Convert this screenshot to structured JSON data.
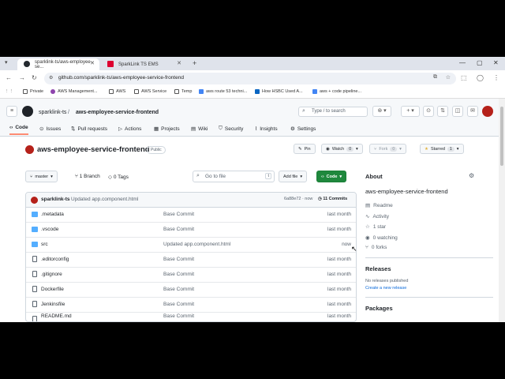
{
  "browser": {
    "tabs": [
      {
        "title": "sparklink-ts/aws-employee-se...",
        "active": true
      },
      {
        "title": "SparkLink TS EMS",
        "active": false
      }
    ],
    "new_tab": "+",
    "url": "github.com/sparklink-ts/aws-employee-service-frontend",
    "bookmarks": [
      "Private",
      "AWS Management...",
      "AWS",
      "AWS Service",
      "Temp",
      "aws route 53 techni...",
      "How HSBC Used A...",
      "aws + code pipeline..."
    ]
  },
  "gh": {
    "owner": "sparklink-ts",
    "sep": "/",
    "repo": "aws-employee-service-frontend",
    "search_placeholder": "Type / to search",
    "nav": [
      "Code",
      "Issues",
      "Pull requests",
      "Actions",
      "Projects",
      "Wiki",
      "Security",
      "Insights",
      "Settings"
    ],
    "repo_title": "aws-employee-service-frontend",
    "visibility": "Public",
    "pin": "Pin",
    "watch": "Watch",
    "watch_count": "0",
    "fork": "Fork",
    "fork_count": "0",
    "starred": "Starred",
    "star_count": "1",
    "branch": "master",
    "branches": "1 Branch",
    "tags": "0 Tags",
    "goto_placeholder": "Go to file",
    "goto_key": "t",
    "add_file": "Add file",
    "code_btn": "Code",
    "commit": {
      "author": "sparklink-ts",
      "message": "Updated app.component.html",
      "hash": "6a88e72 · now",
      "commits": "11 Commits"
    },
    "files": [
      {
        "name": ".metadata",
        "type": "folder",
        "msg": "Base Commit",
        "time": "last month"
      },
      {
        "name": ".vscode",
        "type": "folder",
        "msg": "Base Commit",
        "time": "last month"
      },
      {
        "name": "src",
        "type": "folder",
        "msg": "Updated app.component.html",
        "time": "now"
      },
      {
        "name": ".editorconfig",
        "type": "file",
        "msg": "Base Commit",
        "time": "last month"
      },
      {
        "name": ".gitignore",
        "type": "file",
        "msg": "Base Commit",
        "time": "last month"
      },
      {
        "name": "Dockerfile",
        "type": "file",
        "msg": "Base Commit",
        "time": "last month"
      },
      {
        "name": "Jenkinsfile",
        "type": "file",
        "msg": "Base Commit",
        "time": "last month"
      },
      {
        "name": "README.md",
        "type": "file",
        "msg": "Base Commit",
        "time": "last month"
      }
    ],
    "about": {
      "heading": "About",
      "description": "aws-employee-service-frontend",
      "readme": "Readme",
      "activity": "Activity",
      "stars": "1 star",
      "watching": "0 watching",
      "forks": "0 forks"
    },
    "releases": {
      "heading": "Releases",
      "none": "No releases published",
      "create": "Create a new release"
    },
    "packages": {
      "heading": "Packages"
    }
  }
}
